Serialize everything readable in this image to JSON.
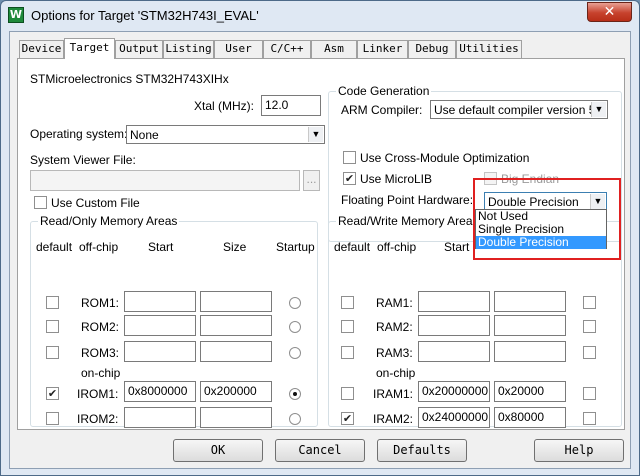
{
  "window": {
    "title": "Options for Target 'STM32H743I_EVAL'",
    "close_glyph": "✕",
    "app_icon_letter": "W"
  },
  "tabs": [
    "Device",
    "Target",
    "Output",
    "Listing",
    "User",
    "C/C++",
    "Asm",
    "Linker",
    "Debug",
    "Utilities"
  ],
  "active_tab": "Target",
  "device_name": "STMicroelectronics STM32H743XIHx",
  "xtal": {
    "label": "Xtal (MHz):",
    "value": "12.0"
  },
  "operating_system": {
    "label": "Operating system:",
    "value": "None"
  },
  "system_viewer": {
    "label": "System Viewer File:",
    "value": "",
    "browse_label": "..."
  },
  "use_custom_file": {
    "label": "Use Custom File",
    "checked": false
  },
  "code_generation": {
    "legend": "Code Generation",
    "arm_compiler_label": "ARM Compiler:",
    "arm_compiler_value": "Use default compiler version 5",
    "cross_module": {
      "label": "Use Cross-Module Optimization",
      "checked": false
    },
    "microlib": {
      "label": "Use MicroLIB",
      "checked": true
    },
    "big_endian": {
      "label": "Big Endian",
      "checked": false,
      "enabled": false
    },
    "fpu_label": "Floating Point Hardware:",
    "fpu_value": "Double Precision",
    "fpu_options": [
      "Not Used",
      "Single Precision",
      "Double Precision"
    ],
    "fpu_selected_option": "Double Precision"
  },
  "ro_memory": {
    "legend": "Read/Only Memory Areas",
    "headers": {
      "default": "default",
      "offchip": "off-chip",
      "start": "Start",
      "size": "Size",
      "startup": "Startup"
    },
    "onchip_label": "on-chip",
    "rows": [
      {
        "name": "ROM1:",
        "start": "",
        "size": "",
        "default": false,
        "startup": false
      },
      {
        "name": "ROM2:",
        "start": "",
        "size": "",
        "default": false,
        "startup": false
      },
      {
        "name": "ROM3:",
        "start": "",
        "size": "",
        "default": false,
        "startup": false
      },
      {
        "name": "IROM1:",
        "start": "0x8000000",
        "size": "0x200000",
        "default": true,
        "startup": true
      },
      {
        "name": "IROM2:",
        "start": "",
        "size": "",
        "default": false,
        "startup": false
      }
    ]
  },
  "rw_memory": {
    "legend": "Read/Write Memory Areas",
    "headers": {
      "default": "default",
      "offchip": "off-chip",
      "start": "Start"
    },
    "onchip_label": "on-chip",
    "rows": [
      {
        "name": "RAM1:",
        "start": "",
        "size": "",
        "default": false,
        "noinit": false
      },
      {
        "name": "RAM2:",
        "start": "",
        "size": "",
        "default": false,
        "noinit": false
      },
      {
        "name": "RAM3:",
        "start": "",
        "size": "",
        "default": false,
        "noinit": false
      },
      {
        "name": "IRAM1:",
        "start": "0x20000000",
        "size": "0x20000",
        "default": false,
        "noinit": false
      },
      {
        "name": "IRAM2:",
        "start": "0x24000000",
        "size": "0x80000",
        "default": true,
        "noinit": false
      }
    ]
  },
  "buttons": {
    "ok": "OK",
    "cancel": "Cancel",
    "defaults": "Defaults",
    "help": "Help"
  },
  "check_glyph": "✔",
  "combo_arrow_glyph": "▼",
  "colors": {
    "highlight_box": "#e02020",
    "selection": "#3399ff"
  }
}
